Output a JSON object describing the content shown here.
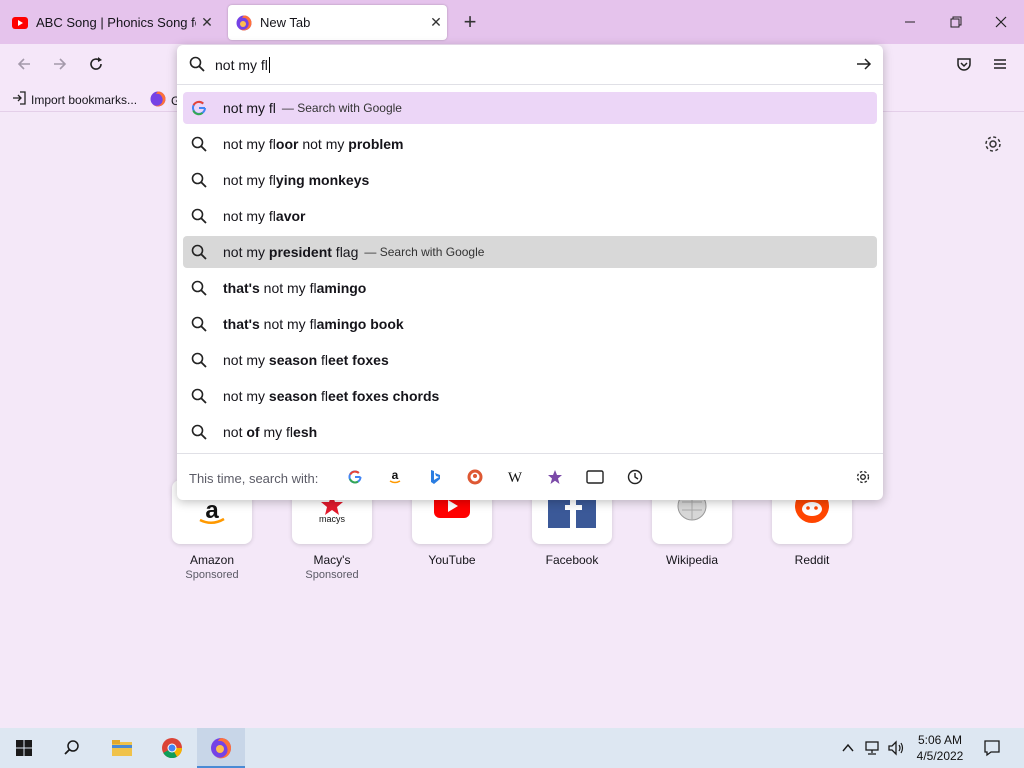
{
  "browser": {
    "tabs": [
      {
        "title": "ABC Song | Phonics Song for Ch",
        "favicon": "youtube-icon"
      },
      {
        "title": "New Tab",
        "favicon": "firefox-icon"
      }
    ],
    "new_tab_symbol": "+",
    "bookmarks": [
      {
        "label": "Import bookmarks..."
      },
      {
        "label": "G"
      }
    ]
  },
  "urlbar": {
    "query": "not my fl",
    "suggestions": [
      {
        "parts": [
          [
            "not my fl",
            false
          ]
        ],
        "hint": "— Search with Google",
        "icon": "google-icon"
      },
      {
        "parts": [
          [
            "not my fl",
            false
          ],
          [
            "oor",
            true
          ],
          [
            " not my ",
            false
          ],
          [
            "problem",
            true
          ]
        ],
        "icon": "search-icon"
      },
      {
        "parts": [
          [
            "not my fl",
            false
          ],
          [
            "ying monkeys",
            true
          ]
        ],
        "icon": "search-icon"
      },
      {
        "parts": [
          [
            "not my fl",
            false
          ],
          [
            "avor",
            true
          ]
        ],
        "icon": "search-icon"
      },
      {
        "parts": [
          [
            "not my ",
            false
          ],
          [
            "president",
            true
          ],
          [
            " flag",
            false
          ]
        ],
        "hint": "— Search with Google",
        "icon": "search-icon"
      },
      {
        "parts": [
          [
            "that's",
            true
          ],
          [
            " not my fl",
            false
          ],
          [
            "amingo",
            true
          ]
        ],
        "icon": "search-icon"
      },
      {
        "parts": [
          [
            "that's",
            true
          ],
          [
            " not my fl",
            false
          ],
          [
            "amingo book",
            true
          ]
        ],
        "icon": "search-icon"
      },
      {
        "parts": [
          [
            "not my ",
            false
          ],
          [
            "season",
            true
          ],
          [
            " fl",
            false
          ],
          [
            "eet foxes",
            true
          ]
        ],
        "icon": "search-icon"
      },
      {
        "parts": [
          [
            "not my ",
            false
          ],
          [
            "season",
            true
          ],
          [
            " fl",
            false
          ],
          [
            "eet foxes chords",
            true
          ]
        ],
        "icon": "search-icon"
      },
      {
        "parts": [
          [
            "not ",
            false
          ],
          [
            "of",
            true
          ],
          [
            " my fl",
            false
          ],
          [
            "esh",
            true
          ]
        ],
        "icon": "search-icon"
      }
    ],
    "oneoff_label": "This time, search with:",
    "engines": [
      "google-icon",
      "amazon-icon",
      "bing-icon",
      "duckduckgo-icon",
      "wikipedia-icon",
      "bookmarks-star-icon",
      "tabs-icon",
      "history-icon"
    ]
  },
  "tiles": [
    {
      "label": "Amazon",
      "sponsored": "Sponsored"
    },
    {
      "label": "Macy's",
      "sponsored": "Sponsored"
    },
    {
      "label": "YouTube",
      "sponsored": ""
    },
    {
      "label": "Facebook",
      "sponsored": ""
    },
    {
      "label": "Wikipedia",
      "sponsored": ""
    },
    {
      "label": "Reddit",
      "sponsored": ""
    }
  ],
  "taskbar": {
    "time": "5:06 AM",
    "date": "4/5/2022"
  },
  "colors": {
    "tabbar": "#e5c3ec",
    "page": "#f4e8f8",
    "selected_row": "#ecd6f7",
    "hover_row": "#d8d8d8"
  }
}
